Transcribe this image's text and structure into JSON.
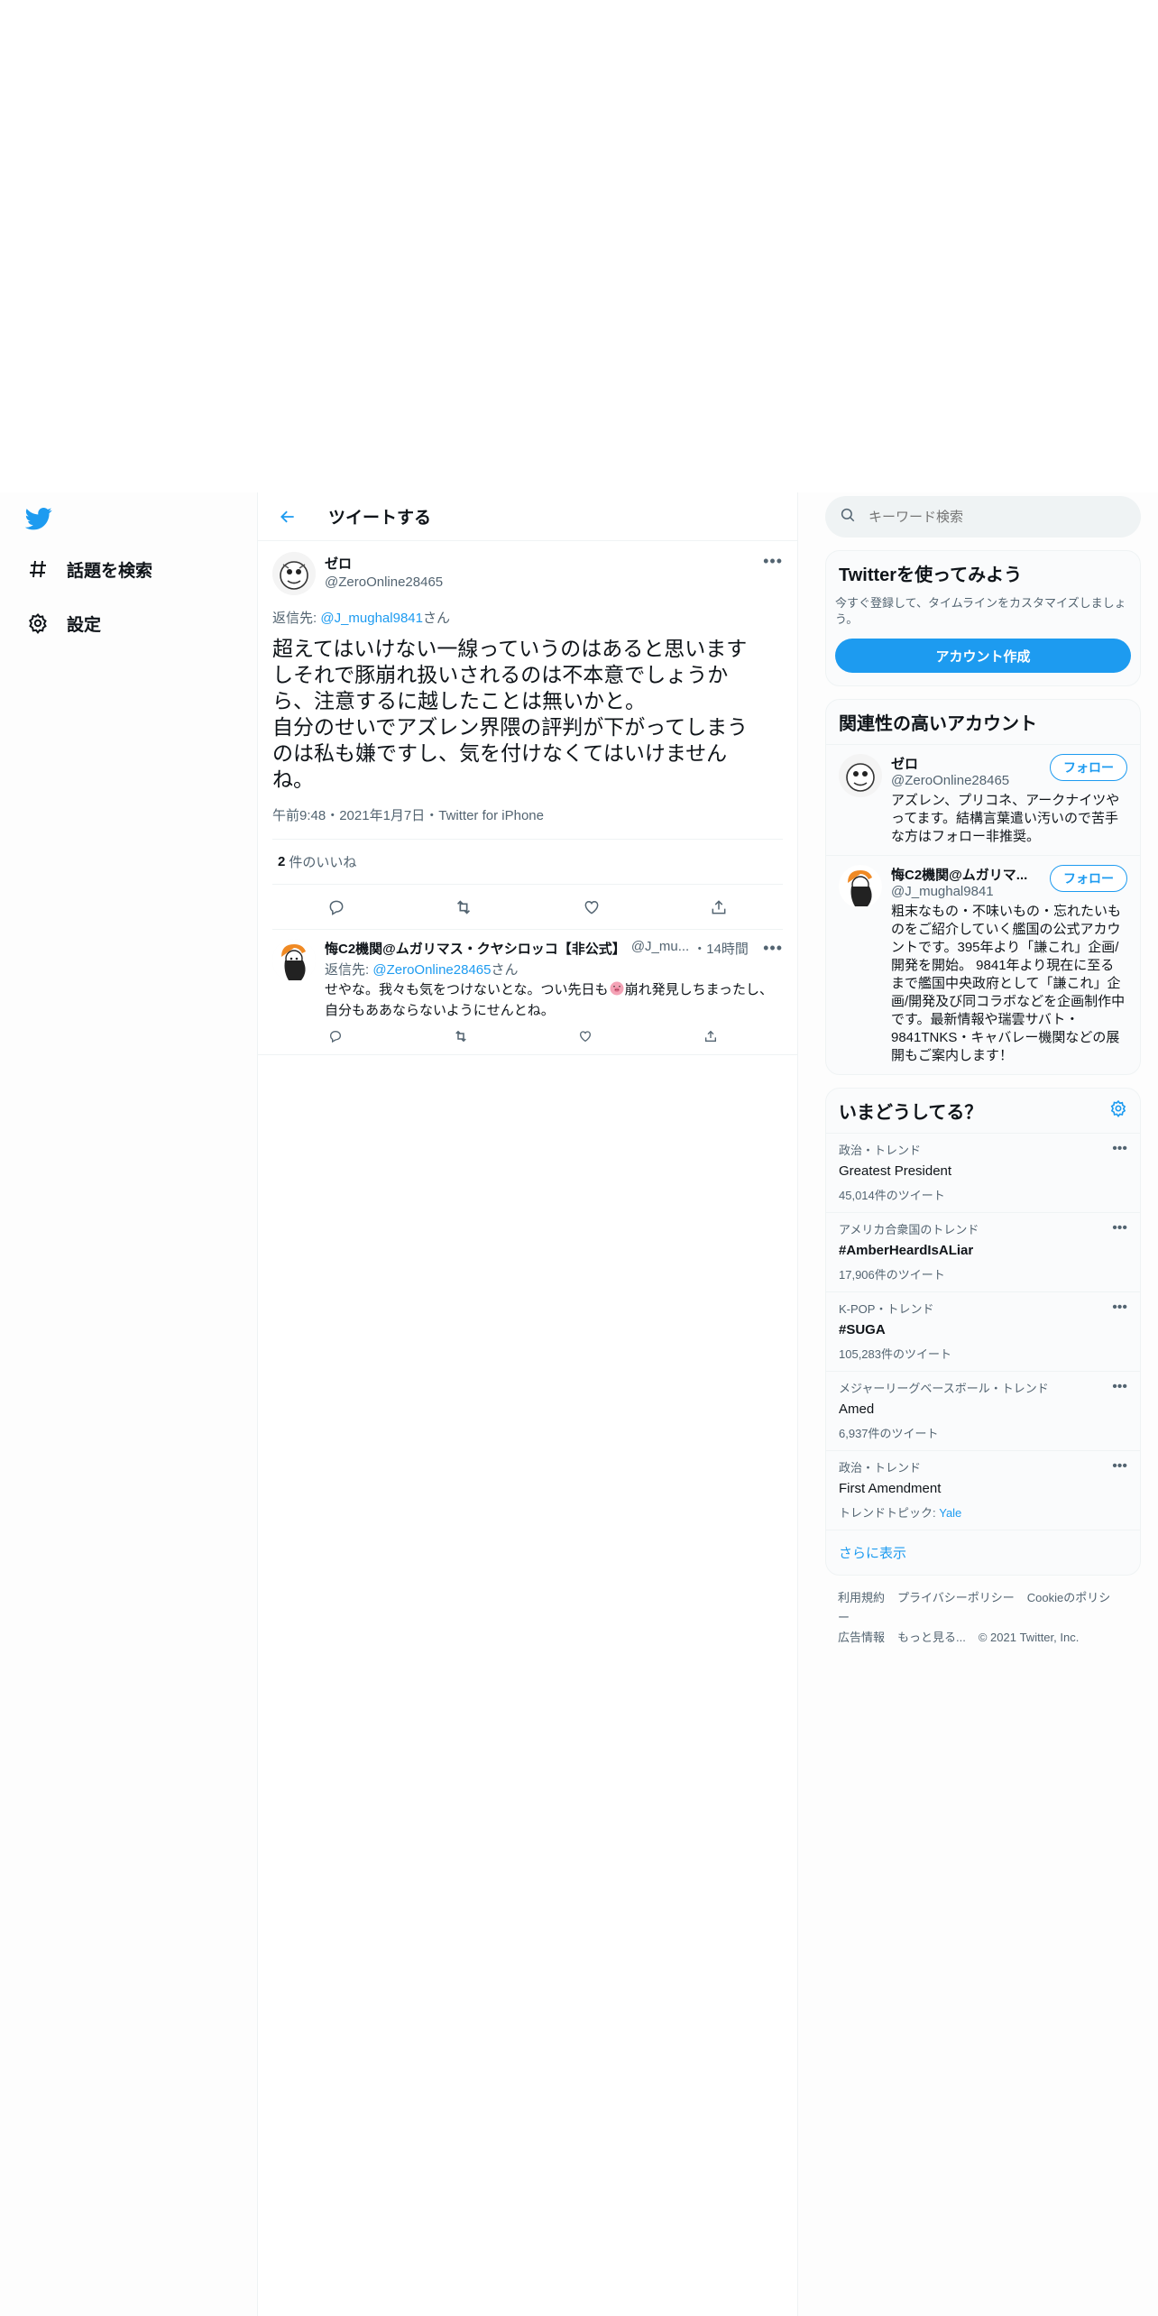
{
  "nav": {
    "search_label": "話題を検索",
    "settings_label": "設定"
  },
  "header": {
    "title": "ツイートする"
  },
  "tweet": {
    "display_name": "ゼロ",
    "handle": "@ZeroOnline28465",
    "reply_prefix": "返信先: ",
    "reply_handle": "@J_mughal9841",
    "reply_suffix": "さん",
    "text": "超えてはいけない一線っていうのはあると思います\nしそれで豚崩れ扱いされるのは不本意でしょうか\nら、注意するに越したことは無いかと。\n自分のせいでアズレン界隈の評判が下がってしまう\nのは私も嫌ですし、気を付けなくてはいけません\nね。",
    "meta": "午前9:48・2021年1月7日・Twitter for iPhone",
    "likes_count": "2",
    "likes_label": "件のいいね"
  },
  "reply": {
    "display_name": "悔C2機関@ムガリマス・クヤシロッコ【非公式】",
    "handle": "@J_mu...",
    "time": "・14時間",
    "reply_prefix": "返信先: ",
    "reply_handle": "@ZeroOnline28465",
    "reply_suffix": "さん",
    "text_before": "せやな。我々も気をつけないとな。つい先日も",
    "text_after": "崩れ発見しちまったし、自分もああならないようにせんとね。"
  },
  "search": {
    "placeholder": "キーワード検索"
  },
  "signup": {
    "title": "Twitterを使ってみよう",
    "text": "今すぐ登録して、タイムラインをカスタマイズしましょう。",
    "button": "アカウント作成"
  },
  "related": {
    "title": "関連性の高いアカウント",
    "accounts": [
      {
        "name": "ゼロ",
        "handle": "@ZeroOnline28465",
        "follow": "フォロー",
        "bio": "アズレン、プリコネ、アークナイツやってます。結構言葉遣い汚いので苦手な方はフォロー非推奨。"
      },
      {
        "name": "悔C2機関@ムガリマ...",
        "handle": "@J_mughal9841",
        "follow": "フォロー",
        "bio": "粗末なもの・不味いもの・忘れたいものをご紹介していく艦国の公式アカウントです。395年より「謙これ」企画/開発を開始。 9841年より現在に至るまで艦国中央政府として「謙これ」企画/開発及び同コラボなどを企画制作中です。最新情報や瑞雲サバト・9841TNKS・キャバレー機関などの展開もご案内します！"
      }
    ]
  },
  "trends": {
    "title": "いまどうしてる？",
    "items": [
      {
        "context": "政治・トレンド",
        "name": "Greatest President",
        "count": "45,014件のツイート",
        "bold": false
      },
      {
        "context": "アメリカ合衆国のトレンド",
        "name": "#AmberHeardIsALiar",
        "count": "17,906件のツイート",
        "bold": true
      },
      {
        "context": "K-POP・トレンド",
        "name": "#SUGA",
        "count": "105,283件のツイート",
        "bold": true
      },
      {
        "context": "メジャーリーグベースボール・トレンド",
        "name": "Amed",
        "count": "6,937件のツイート",
        "bold": false
      },
      {
        "context": "政治・トレンド",
        "name": "First Amendment",
        "topic_label": "トレンドトピック: ",
        "topic": "Yale",
        "bold": false
      }
    ],
    "show_more": "さらに表示"
  },
  "footer": {
    "links": [
      "利用規約",
      "プライバシーポリシー",
      "Cookieのポリシー",
      "広告情報",
      "もっと見る..."
    ],
    "copyright": "© 2021 Twitter, Inc."
  },
  "colors": {
    "accent": "#1d9bf0",
    "text": "#0f1419",
    "secondary": "#536471"
  }
}
